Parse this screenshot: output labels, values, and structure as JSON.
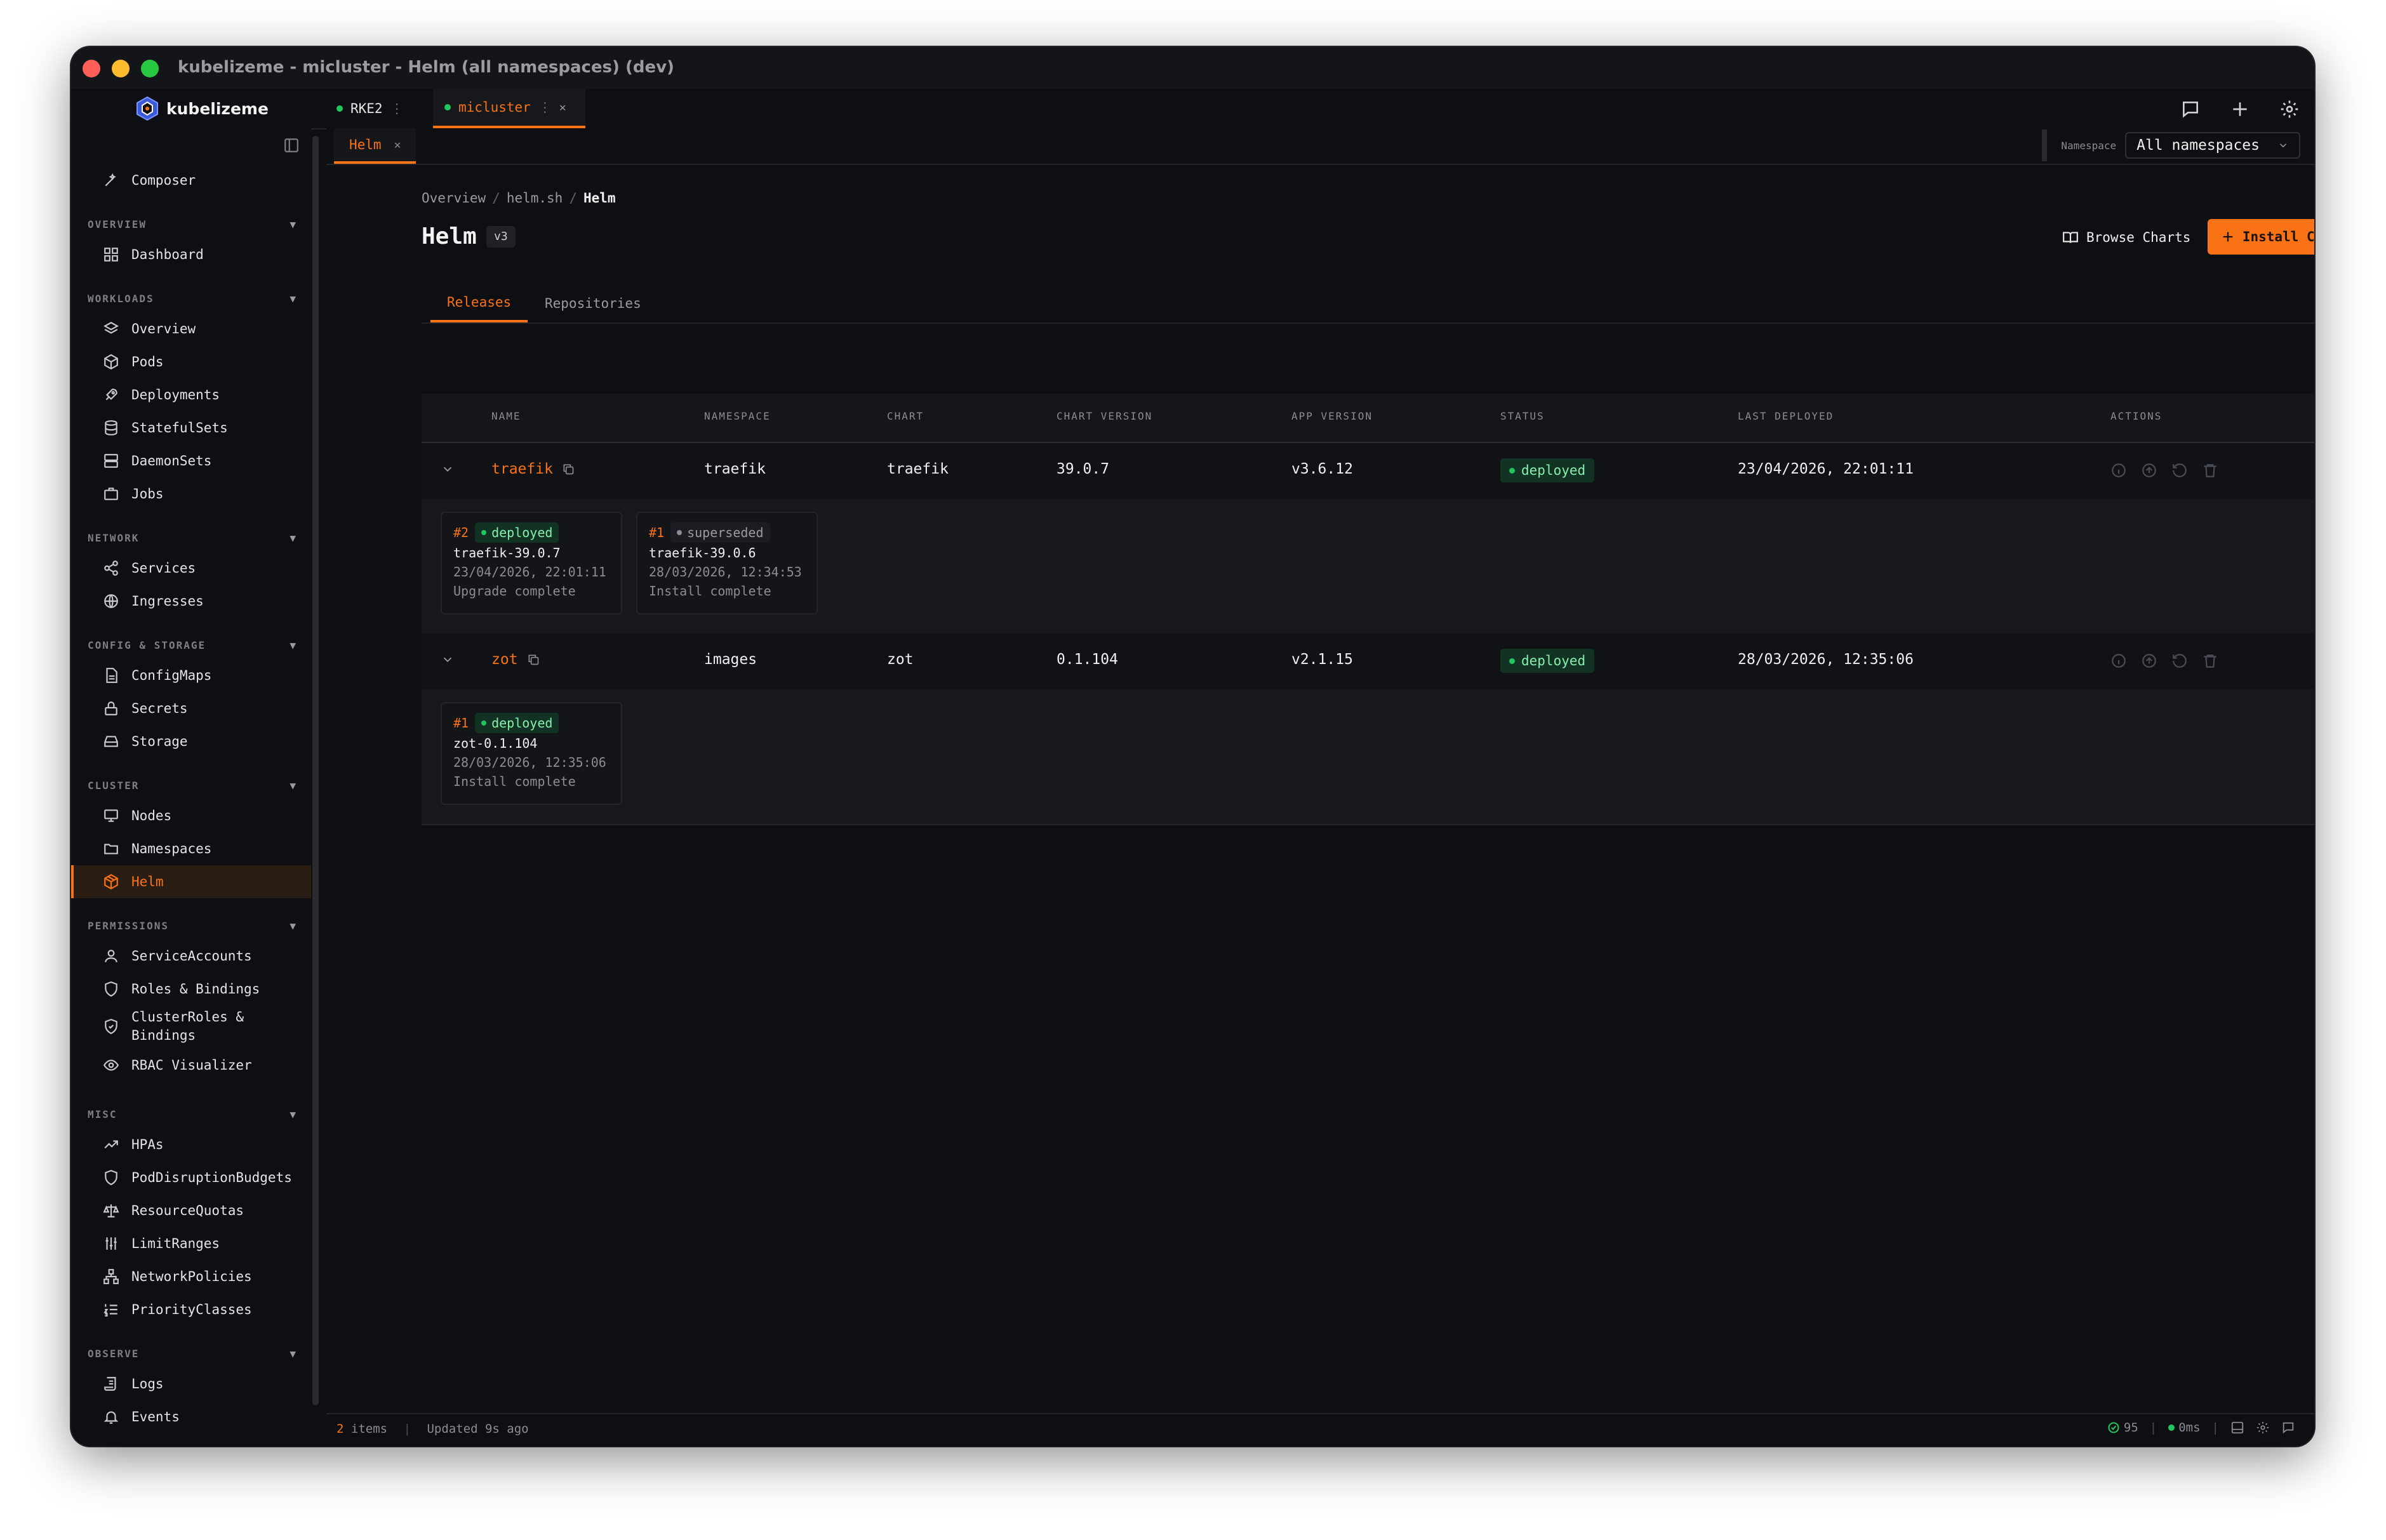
{
  "window": {
    "title": "kubelizeme - micluster - Helm (all namespaces) (dev)",
    "traffic_lights": [
      "#ff5f57",
      "#febc2e",
      "#28c840"
    ]
  },
  "brand": {
    "name": "kubelizeme"
  },
  "cluster_tabs": [
    {
      "label": "RKE2",
      "active": false
    },
    {
      "label": "micluster",
      "active": true
    }
  ],
  "top_icons": [
    "chat-bubble-icon",
    "plus-icon",
    "gear-icon"
  ],
  "sidebar": {
    "composer": "Composer",
    "sections": [
      {
        "title": "OVERVIEW",
        "items": [
          {
            "label": "Dashboard",
            "icon": "dashboard-icon"
          }
        ]
      },
      {
        "title": "WORKLOADS",
        "items": [
          {
            "label": "Overview",
            "icon": "layers-icon"
          },
          {
            "label": "Pods",
            "icon": "cube-icon"
          },
          {
            "label": "Deployments",
            "icon": "rocket-icon"
          },
          {
            "label": "StatefulSets",
            "icon": "database-icon"
          },
          {
            "label": "DaemonSets",
            "icon": "server-icon"
          },
          {
            "label": "Jobs",
            "icon": "briefcase-icon"
          }
        ]
      },
      {
        "title": "NETWORK",
        "items": [
          {
            "label": "Services",
            "icon": "share-icon"
          },
          {
            "label": "Ingresses",
            "icon": "globe-icon"
          }
        ]
      },
      {
        "title": "CONFIG & STORAGE",
        "items": [
          {
            "label": "ConfigMaps",
            "icon": "file-icon"
          },
          {
            "label": "Secrets",
            "icon": "lock-icon"
          },
          {
            "label": "Storage",
            "icon": "hard-drive-icon"
          }
        ]
      },
      {
        "title": "CLUSTER",
        "items": [
          {
            "label": "Nodes",
            "icon": "monitor-icon"
          },
          {
            "label": "Namespaces",
            "icon": "folder-icon"
          },
          {
            "label": "Helm",
            "icon": "package-icon",
            "active": true
          }
        ]
      },
      {
        "title": "PERMISSIONS",
        "items": [
          {
            "label": "ServiceAccounts",
            "icon": "user-icon"
          },
          {
            "label": "Roles & Bindings",
            "icon": "shield-icon"
          },
          {
            "label": "ClusterRoles & Bindings",
            "icon": "shield-check-icon"
          },
          {
            "label": "RBAC Visualizer",
            "icon": "eye-icon"
          }
        ]
      },
      {
        "title": "MISC",
        "items": [
          {
            "label": "HPAs",
            "icon": "trending-up-icon"
          },
          {
            "label": "PodDisruptionBudgets",
            "icon": "shield-icon"
          },
          {
            "label": "ResourceQuotas",
            "icon": "scale-icon"
          },
          {
            "label": "LimitRanges",
            "icon": "sliders-icon"
          },
          {
            "label": "NetworkPolicies",
            "icon": "network-icon"
          },
          {
            "label": "PriorityClasses",
            "icon": "list-ordered-icon"
          }
        ]
      },
      {
        "title": "OBSERVE",
        "items": [
          {
            "label": "Logs",
            "icon": "scroll-icon"
          },
          {
            "label": "Events",
            "icon": "bell-icon"
          }
        ]
      }
    ]
  },
  "subtab": {
    "label": "Helm"
  },
  "namespace": {
    "label": "Namespace",
    "value": "All namespaces"
  },
  "breadcrumb": [
    "Overview",
    "helm.sh",
    "Helm"
  ],
  "page": {
    "title": "Helm",
    "version": "v3"
  },
  "buttons": {
    "browse": "Browse Charts",
    "install": "Install Chart"
  },
  "page_tabs": [
    {
      "label": "Releases",
      "active": true
    },
    {
      "label": "Repositories",
      "active": false
    }
  ],
  "table": {
    "columns": [
      "NAME",
      "NAMESPACE",
      "CHART",
      "CHART VERSION",
      "APP VERSION",
      "STATUS",
      "LAST DEPLOYED",
      "ACTIONS"
    ],
    "rows": [
      {
        "name": "traefik",
        "namespace": "traefik",
        "chart": "traefik",
        "chart_version": "39.0.7",
        "app_version": "v3.6.12",
        "status": "deployed",
        "last_deployed": "23/04/2026, 22:01:11",
        "revisions": [
          {
            "num": "#2",
            "status": "deployed",
            "chart": "traefik-39.0.7",
            "date": "23/04/2026, 22:01:11",
            "desc": "Upgrade complete"
          },
          {
            "num": "#1",
            "status": "superseded",
            "chart": "traefik-39.0.6",
            "date": "28/03/2026, 12:34:53",
            "desc": "Install complete"
          }
        ]
      },
      {
        "name": "zot",
        "namespace": "images",
        "chart": "zot",
        "chart_version": "0.1.104",
        "app_version": "v2.1.15",
        "status": "deployed",
        "last_deployed": "28/03/2026, 12:35:06",
        "revisions": [
          {
            "num": "#1",
            "status": "deployed",
            "chart": "zot-0.1.104",
            "date": "28/03/2026, 12:35:06",
            "desc": "Install complete"
          }
        ]
      }
    ]
  },
  "statusbar": {
    "count": "2",
    "count_label": "items",
    "updated": "Updated 9s ago",
    "health": "95",
    "latency": "0ms"
  },
  "colors": {
    "accent": "#f97316",
    "ok": "#22c55e",
    "bg": "#0e0f12"
  }
}
